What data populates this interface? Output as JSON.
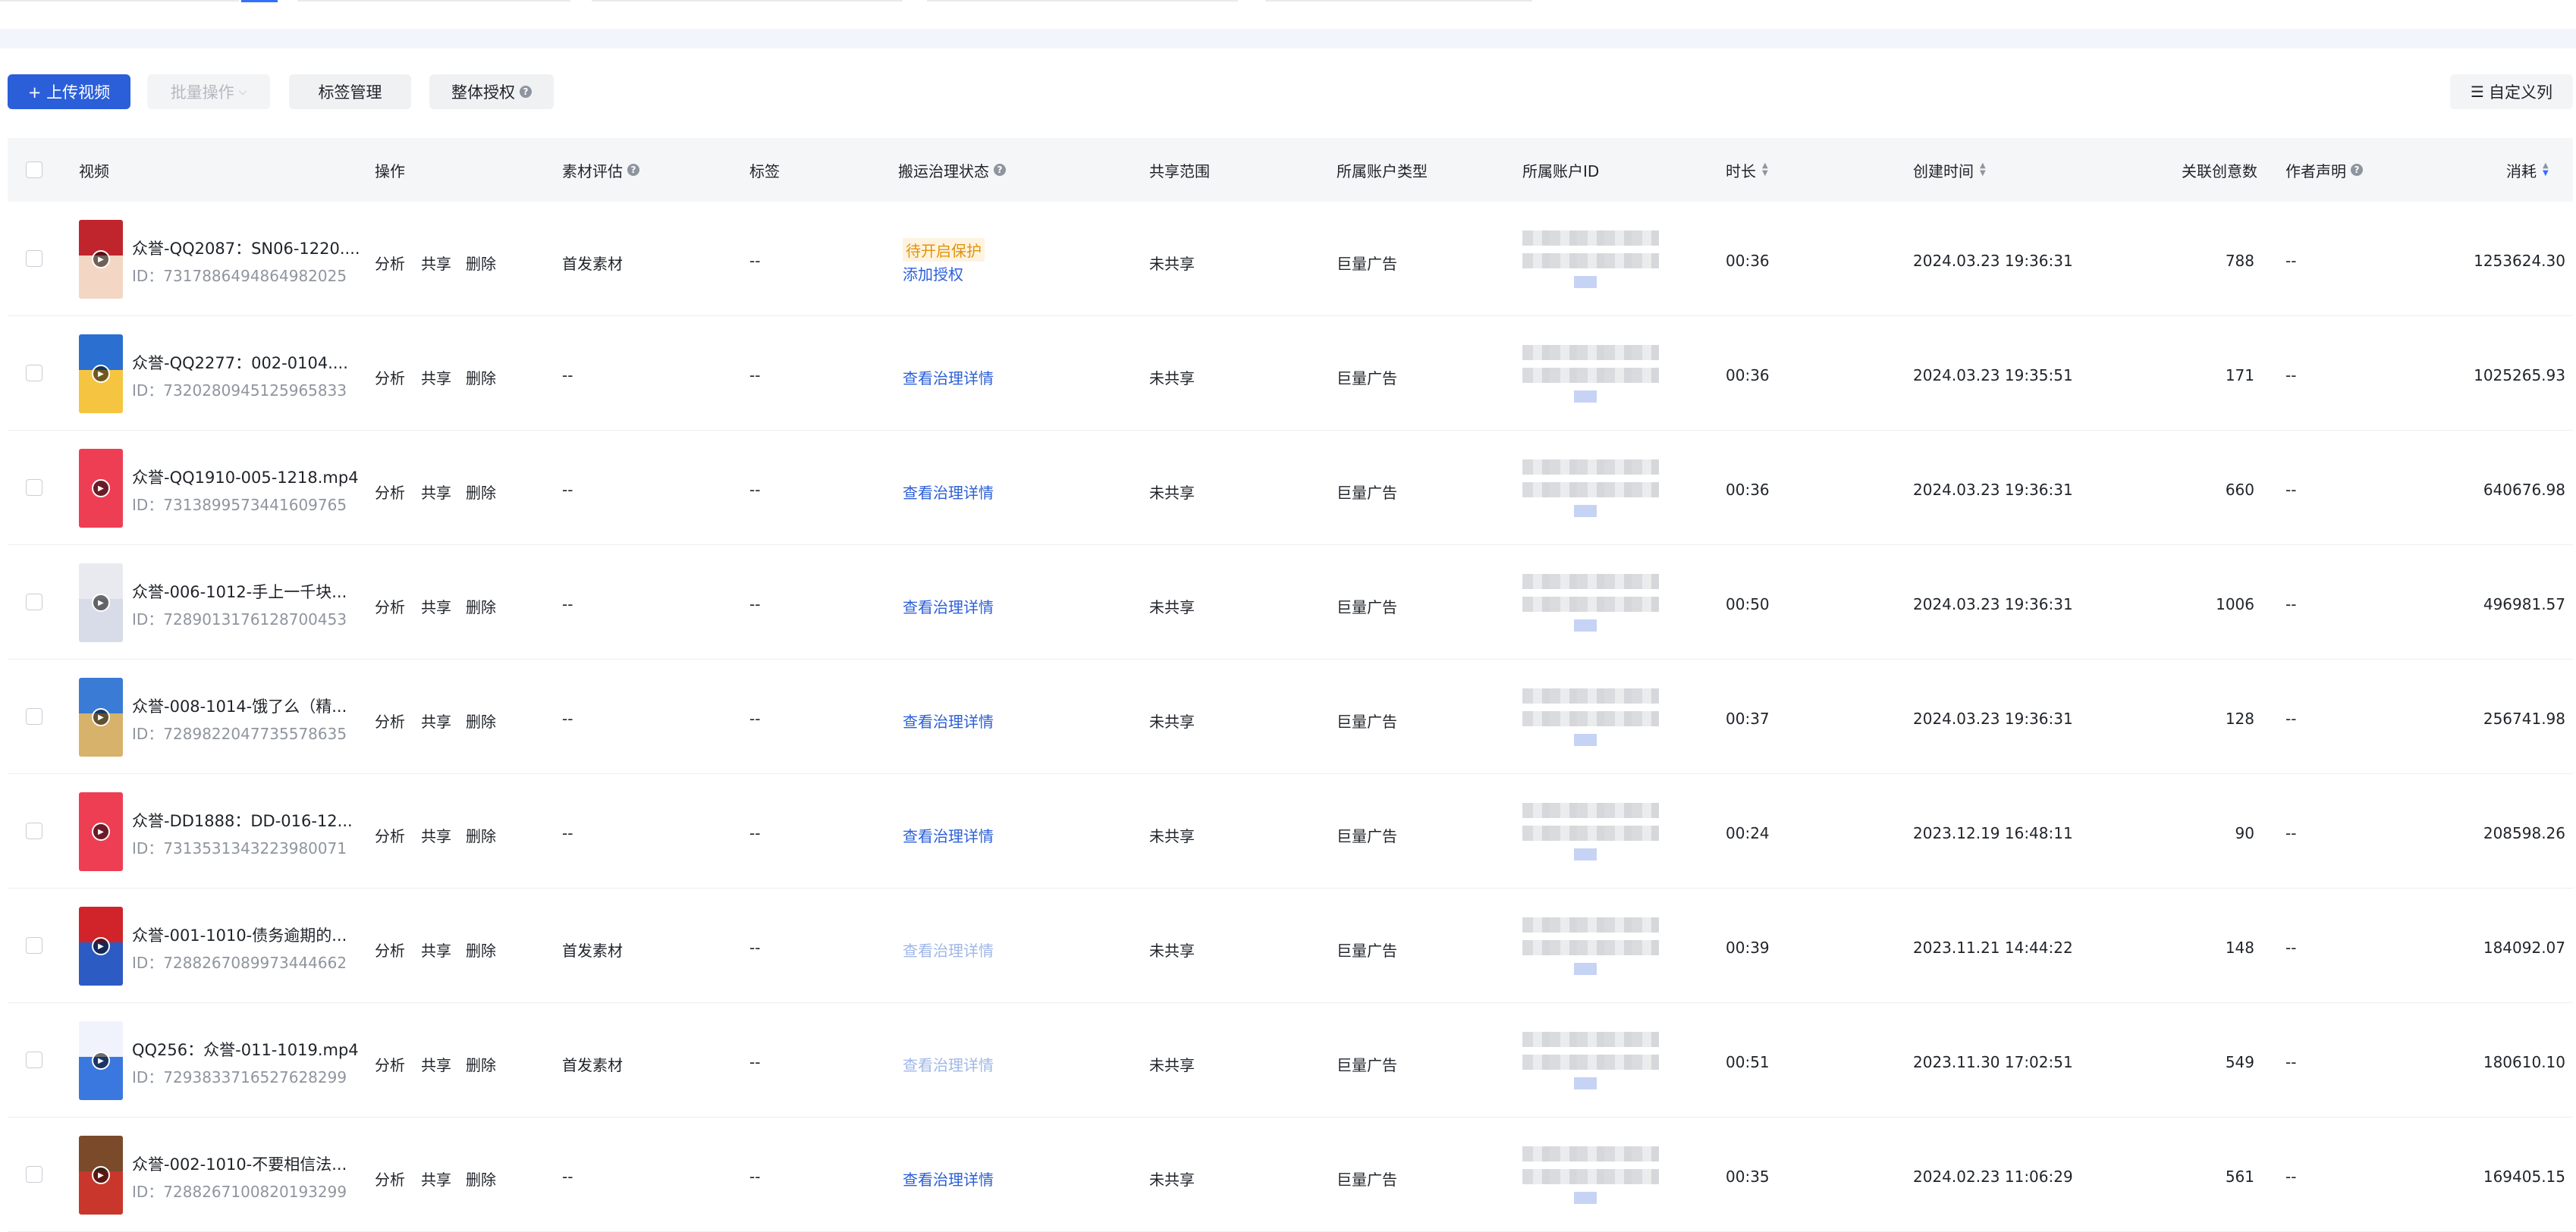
{
  "toolbar": {
    "upload_label": "+ 上传视频",
    "batch_label": "批量操作",
    "tag_label": "标签管理",
    "auth_label": "整体授权",
    "custom_label": "自定义列"
  },
  "columns": {
    "video": "视频",
    "ops": "操作",
    "eval": "素材评估",
    "tags": "标签",
    "gov": "搬运治理状态",
    "share": "共享范围",
    "acct_type": "所属账户类型",
    "acct_id": "所属账户ID",
    "duration": "时长",
    "created": "创建时间",
    "creatives": "关联创意数",
    "author": "作者声明",
    "cost": "消耗"
  },
  "ops": {
    "analyze": "分析",
    "share": "共享",
    "delete": "删除"
  },
  "rows": [
    {
      "name": "众誉-QQ2087：SN06-1220....",
      "id": "ID：7317886494864982025",
      "eval": "首发素材",
      "tags": "--",
      "gov_a": "待开启保护",
      "gov_b": "添加授权",
      "share": "未共享",
      "acct_type": "巨量广告",
      "duration": "00:36",
      "created": "2024.03.23 19:36:31",
      "creatives": "788",
      "author": "--",
      "cost": "1253624.30"
    },
    {
      "name": "众誉-QQ2277：002-0104....",
      "id": "ID：7320280945125965833",
      "eval": "--",
      "tags": "--",
      "gov": "查看治理详情",
      "share": "未共享",
      "acct_type": "巨量广告",
      "duration": "00:36",
      "created": "2024.03.23 19:35:51",
      "creatives": "171",
      "author": "--",
      "cost": "1025265.93"
    },
    {
      "name": "众誉-QQ1910-005-1218.mp4",
      "id": "ID：7313899573441609765",
      "eval": "--",
      "tags": "--",
      "gov": "查看治理详情",
      "share": "未共享",
      "acct_type": "巨量广告",
      "duration": "00:36",
      "created": "2024.03.23 19:36:31",
      "creatives": "660",
      "author": "--",
      "cost": "640676.98"
    },
    {
      "name": "众誉-006-1012-手上一千块...",
      "id": "ID：7289013176128700453",
      "eval": "--",
      "tags": "--",
      "gov": "查看治理详情",
      "share": "未共享",
      "acct_type": "巨量广告",
      "duration": "00:50",
      "created": "2024.03.23 19:36:31",
      "creatives": "1006",
      "author": "--",
      "cost": "496981.57"
    },
    {
      "name": "众誉-008-1014-饿了么（精...",
      "id": "ID：7289822047735578635",
      "eval": "--",
      "tags": "--",
      "gov": "查看治理详情",
      "share": "未共享",
      "acct_type": "巨量广告",
      "duration": "00:37",
      "created": "2024.03.23 19:36:31",
      "creatives": "128",
      "author": "--",
      "cost": "256741.98"
    },
    {
      "name": "众誉-DD1888：DD-016-12...",
      "id": "ID：7313531343223980071",
      "eval": "--",
      "tags": "--",
      "gov": "查看治理详情",
      "share": "未共享",
      "acct_type": "巨量广告",
      "duration": "00:24",
      "created": "2023.12.19 16:48:11",
      "creatives": "90",
      "author": "--",
      "cost": "208598.26"
    },
    {
      "name": "众誉-001-1010-债务逾期的...",
      "id": "ID：7288267089973444662",
      "eval": "首发素材",
      "tags": "--",
      "gov": "查看治理详情",
      "share": "未共享",
      "acct_type": "巨量广告",
      "duration": "00:39",
      "created": "2023.11.21 14:44:22",
      "creatives": "148",
      "author": "--",
      "cost": "184092.07"
    },
    {
      "name": "QQ256：众誉-011-1019.mp4",
      "id": "ID：7293833716527628299",
      "eval": "首发素材",
      "tags": "--",
      "gov": "查看治理详情",
      "share": "未共享",
      "acct_type": "巨量广告",
      "duration": "00:51",
      "created": "2023.11.30 17:02:51",
      "creatives": "549",
      "author": "--",
      "cost": "180610.10"
    },
    {
      "name": "众誉-002-1010-不要相信法...",
      "id": "ID：7288267100820193299",
      "eval": "--",
      "tags": "--",
      "gov": "查看治理详情",
      "share": "未共享",
      "acct_type": "巨量广告",
      "duration": "00:35",
      "created": "2024.02.23 11:06:29",
      "creatives": "561",
      "author": "--",
      "cost": "169405.15"
    }
  ],
  "colors": {
    "primary": "#2b5fd9",
    "link": "#2b5fd9",
    "warn": "#e0940a"
  }
}
